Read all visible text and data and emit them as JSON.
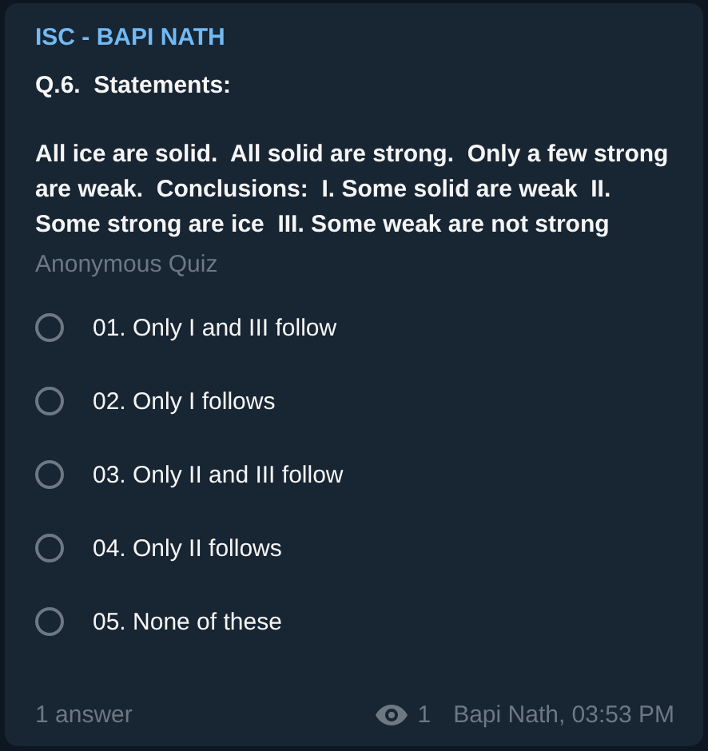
{
  "channel": "ISC - BAPI NATH",
  "question_title": "Q.6.  Statements:",
  "question_body": "All ice are solid.  All solid are strong.  Only a few strong are weak.  Conclusions:  I. Some solid are weak  II. Some strong are ice  III. Some weak are not strong",
  "quiz_type": "Anonymous Quiz",
  "options": [
    {
      "label": "01. Only I and III follow",
      "selected": false
    },
    {
      "label": "02. Only I follows",
      "selected": false
    },
    {
      "label": "03. Only II and III follow",
      "selected": false
    },
    {
      "label": "04. Only II follows",
      "selected": false
    },
    {
      "label": "05. None of these",
      "selected": false
    }
  ],
  "footer": {
    "answers": "1 answer",
    "views": "1",
    "author_time": "Bapi Nath, 03:53 PM"
  }
}
